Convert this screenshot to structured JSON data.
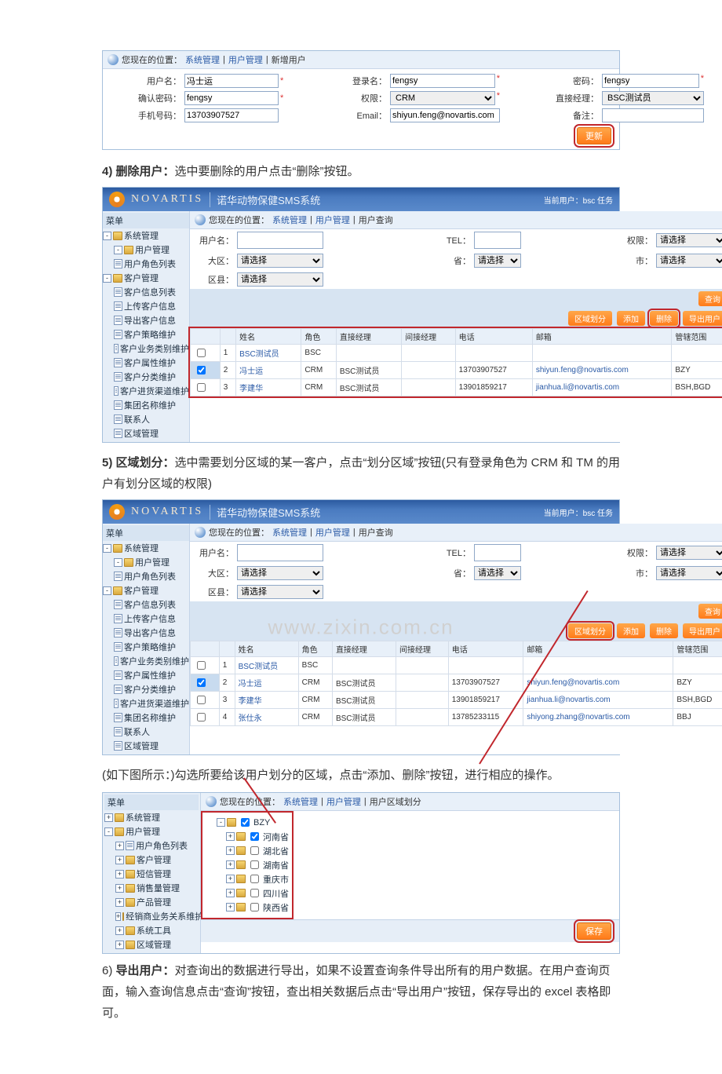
{
  "form1": {
    "breadcrumb": {
      "prefix": "您现在的位置：",
      "p1": "系统管理",
      "p2": "用户管理",
      "p3": "新增用户"
    },
    "labels": {
      "username": "用户名：",
      "login": "登录名：",
      "password": "密码：",
      "confirm": "确认密码：",
      "role": "权限：",
      "manager": "直接经理：",
      "phone": "手机号码：",
      "email": "Email：",
      "remark": "备注："
    },
    "values": {
      "username": "冯士运",
      "login": "fengsy",
      "password": "fengsy",
      "confirm": "fengsy",
      "role": "CRM",
      "manager": "BSC测试员",
      "phone": "13703907527",
      "email": "shiyun.feng@novartis.com",
      "remark": ""
    },
    "btn": "更新"
  },
  "step4": {
    "num": "4)",
    "title": "删除用户：",
    "body": "选中要删除的用户点击“删除”按钮。"
  },
  "app": {
    "brand": "NOVARTIS",
    "title": "诺华动物保健SMS系统",
    "right": "当前用户：bsc     任务",
    "breadcrumb": {
      "prefix": "您现在的位置：",
      "p1": "系统管理",
      "p2": "用户管理",
      "p3": "用户查询"
    },
    "menu_hdr": "菜单",
    "sidebar1": [
      "系统管理",
      "用户管理",
      "用户角色列表",
      "客户管理",
      "客户信息列表",
      "上传客户信息",
      "导出客户信息",
      "客户策略维护",
      "客户业务类别维护",
      "客户属性维护",
      "客户分类维护",
      "客户进货渠道维护",
      "集团名称维护",
      "联系人",
      "区域管理"
    ],
    "sidebar2": [
      "系统管理",
      "用户管理",
      "用户角色列表",
      "客户管理",
      "客户信息列表",
      "上传客户信息",
      "导出客户信息",
      "客户策略维护",
      "客户业务类别维护",
      "客户属性维护",
      "客户分类维护",
      "客户进货渠道维护",
      "集团名称维护",
      "联系人",
      "区域管理"
    ],
    "filters": {
      "username": "用户名：",
      "tel": "TEL：",
      "role": "权限：",
      "region": "大区：",
      "province": "省：",
      "city": "市：",
      "district": "区县：",
      "opt": "请选择"
    },
    "actions1": {
      "query": "查询",
      "area": "区域划分",
      "add": "添加",
      "del": "删除",
      "export": "导出用户"
    },
    "actions2": {
      "query": "查询",
      "area": "区域划分",
      "add": "添加",
      "del": "删除",
      "export": "导出用户"
    },
    "table_hdr": [
      "",
      "",
      "姓名",
      "角色",
      "直接经理",
      "间接经理",
      "电话",
      "邮箱",
      "管辖范围"
    ],
    "rows1": [
      {
        "n": "1",
        "name": "BSC测试员",
        "role": "BSC",
        "mgr": "",
        "tel": "",
        "mail": "",
        "scope": ""
      },
      {
        "n": "2",
        "name": "冯士运",
        "role": "CRM",
        "mgr": "BSC测试员",
        "tel": "13703907527",
        "mail": "shiyun.feng@novartis.com",
        "scope": "BZY",
        "checked": true
      },
      {
        "n": "3",
        "name": "李建华",
        "role": "CRM",
        "mgr": "BSC测试员",
        "tel": "13901859217",
        "mail": "jianhua.li@novartis.com",
        "scope": "BSH,BGD"
      }
    ],
    "rows2": [
      {
        "n": "1",
        "name": "BSC测试员",
        "role": "BSC",
        "mgr": "",
        "tel": "",
        "mail": "",
        "scope": ""
      },
      {
        "n": "2",
        "name": "冯士运",
        "role": "CRM",
        "mgr": "BSC测试员",
        "tel": "13703907527",
        "mail": "shiyun.feng@novartis.com",
        "scope": "BZY",
        "checked": true
      },
      {
        "n": "3",
        "name": "李建华",
        "role": "CRM",
        "mgr": "BSC测试员",
        "tel": "13901859217",
        "mail": "jianhua.li@novartis.com",
        "scope": "BSH,BGD"
      },
      {
        "n": "4",
        "name": "张仕永",
        "role": "CRM",
        "mgr": "BSC测试员",
        "tel": "13785233115",
        "mail": "shiyong.zhang@novartis.com",
        "scope": "BBJ"
      }
    ]
  },
  "step5": {
    "num": "5)",
    "title": "区域划分：",
    "body": "选中需要划分区域的某一客户，点击“划分区域”按钮(只有登录角色为 CRM 和 TM 的用户有划分区域的权限)"
  },
  "step5b": {
    "body": "(如下图所示：)勾选所要给该用户划分的区域，点击“添加、删除”按钮，进行相应的操作。"
  },
  "tree": {
    "menu_hdr": "菜单",
    "breadcrumb": {
      "prefix": "您现在的位置：",
      "p1": "系统管理",
      "p2": "用户管理",
      "p3": "用户区域划分"
    },
    "sidebar": [
      "系统管理",
      "用户管理",
      "用户角色列表",
      "客户管理",
      "短信管理",
      "销售量管理",
      "产品管理",
      "经销商业务关系维护",
      "系统工具",
      "区域管理"
    ],
    "nodes": [
      {
        "lvl": 0,
        "chk": true,
        "label": "BZY"
      },
      {
        "lvl": 1,
        "chk": true,
        "label": "河南省"
      },
      {
        "lvl": 1,
        "chk": false,
        "label": "湖北省"
      },
      {
        "lvl": 1,
        "chk": false,
        "label": "湖南省"
      },
      {
        "lvl": 1,
        "chk": false,
        "label": "重庆市"
      },
      {
        "lvl": 1,
        "chk": false,
        "label": "四川省"
      },
      {
        "lvl": 1,
        "chk": false,
        "label": "陕西省"
      }
    ],
    "save": "保存"
  },
  "step6": {
    "num": "6)",
    "title": "导出用户：",
    "body": "对查询出的数据进行导出，如果不设置查询条件导出所有的用户数据。在用户查询页面，输入查询信息点击“查询”按钮，查出相关数据后点击“导出用户”按钮，保存导出的 excel 表格即可。"
  },
  "watermark": "www.zixin.com.cn"
}
